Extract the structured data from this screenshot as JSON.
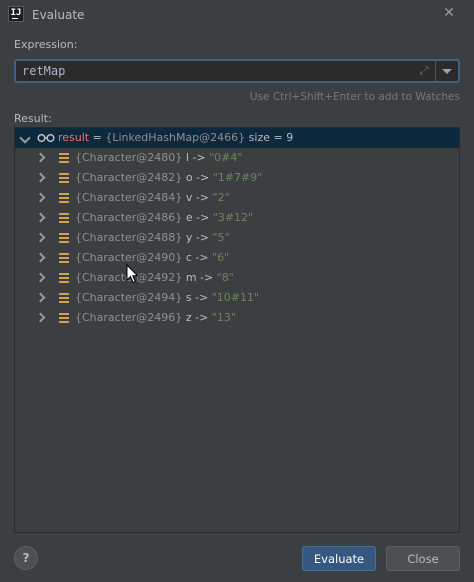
{
  "window": {
    "title": "Evaluate",
    "close_icon": "close-icon",
    "app_icon": "intellij-icon",
    "app_icon_text": "IJ"
  },
  "expression": {
    "label": "Expression:",
    "value": "retMap",
    "hint": "Use Ctrl+Shift+Enter to add to Watches"
  },
  "result": {
    "label": "Result:",
    "root": {
      "name": "result",
      "eq": " = ",
      "type": "{LinkedHashMap@2466}",
      "size": "size = 9"
    },
    "entries": [
      {
        "obj": "{Character@2480}",
        "key": "l",
        "arrow": "->",
        "value": "\"0#4\""
      },
      {
        "obj": "{Character@2482}",
        "key": "o",
        "arrow": "->",
        "value": "\"1#7#9\""
      },
      {
        "obj": "{Character@2484}",
        "key": "v",
        "arrow": "->",
        "value": "\"2\""
      },
      {
        "obj": "{Character@2486}",
        "key": "e",
        "arrow": "->",
        "value": "\"3#12\""
      },
      {
        "obj": "{Character@2488}",
        "key": "y",
        "arrow": "->",
        "value": "\"5\""
      },
      {
        "obj": "{Character@2490}",
        "key": "c",
        "arrow": "->",
        "value": "\"6\""
      },
      {
        "obj": "{Character@2492}",
        "key": "m",
        "arrow": "->",
        "value": "\"8\""
      },
      {
        "obj": "{Character@2494}",
        "key": "s",
        "arrow": "->",
        "value": "\"10#11\""
      },
      {
        "obj": "{Character@2496}",
        "key": "z",
        "arrow": "->",
        "value": "\"13\""
      }
    ]
  },
  "buttons": {
    "help": "?",
    "evaluate": "Evaluate",
    "close": "Close"
  },
  "colors": {
    "background": "#3c3f41",
    "selection": "#0d293e",
    "accent_button": "#365880",
    "variable_name": "#ff6b68",
    "string_value": "#6a8759"
  }
}
